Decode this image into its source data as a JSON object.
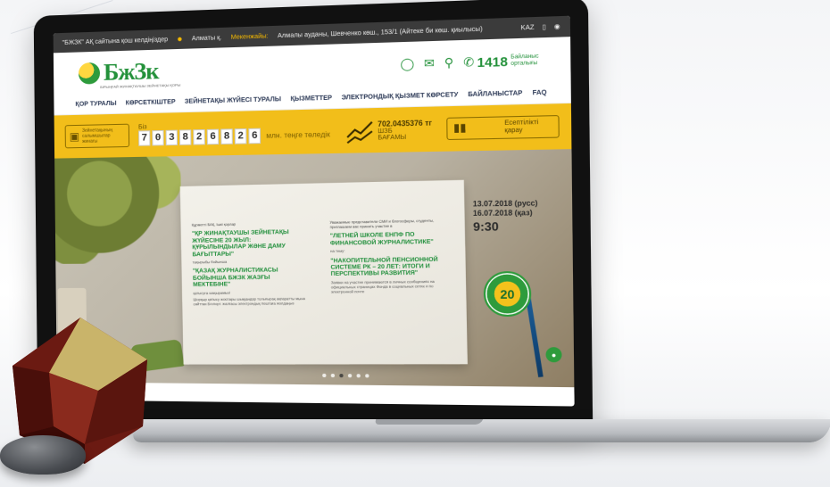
{
  "topbar": {
    "org_text": "\"БЖЗК\" АҚ сайтына қош келдіңіздер",
    "city": "Алматы қ.",
    "address_label": "Мекенжайы:",
    "address": "Алмалы ауданы, Шевченко көш., 153/1 (Айтеке би көш. қиылысы)",
    "lang": "KAZ"
  },
  "header": {
    "logo_text": "БжЗк",
    "logo_sub": "БІРЫҢҒАЙ ЖИНАҚТАУШЫ ЗЕЙНЕТАҚЫ ҚОРЫ",
    "phone": "1418",
    "phone_sub": "Байланыс орталығы"
  },
  "nav": {
    "items": [
      "ҚОР ТУРАЛЫ",
      "КӨРСЕТКІШТЕР",
      "ЗЕЙНЕТАҚЫ ЖҮЙЕСІ ТУРАЛЫ",
      "ҚЫЗМЕТТЕР",
      "ЭЛЕКТРОНДЫҚ ҚЫЗМЕТ КӨРСЕТУ",
      "БАЙЛАНЫСТАР",
      "FAQ"
    ]
  },
  "yellowbar": {
    "box_label": "Зейнетақының салымшылар жинағы",
    "counter_label": "Біз",
    "digits": [
      "7",
      "0",
      "3",
      "8",
      "2",
      "6",
      "8",
      "2",
      "6"
    ],
    "counter_unit": "млн. теңге төледік",
    "rate_value": "702.0435376 тг",
    "rate_label1": "ШЗБ",
    "rate_label2": "БАҒАМЫ",
    "report_label": "Есептілікті қарау"
  },
  "hero": {
    "left": {
      "intro": "Құрметті БАҚ, Ішкі қорлар",
      "headline1": "\"ҚР ЖИНАҚТАУШЫ ЗЕЙНЕТАҚЫ ЖҮЙЕСІНЕ 20 ЖЫЛ: ҚҰРЫЛЫНДЫЛАР ЖӘНЕ ДАМУ БАҒЫТТАРЫ\"",
      "sub1": "тақырыбы бойынша",
      "headline2": "\"ҚАЗАҚ ЖУРНАЛИСТИКАСЫ БОЙЫНША БЖЗК ЖАЗҒЫ МЕКТЕБІНЕ\"",
      "sub2": "қатысуға шақырамыз!",
      "footer": "Шорқыр қатысу жоспары шыққандар толығырақ ақпаратты мына сайттан Бгспорт. жалғасы электрондық поштаға жолдаңыз"
    },
    "right": {
      "intro": "Уважаемые представители СМИ и блогосферы, студенты, приглашаем вас принять участие в",
      "headline1": "\"ЛЕТНЕЙ ШКОЛЕ ЕНПФ ПО ФИНАНСОВОЙ ЖУРНАЛИСТИКЕ\"",
      "sub1": "на тему:",
      "headline2": "\"НАКОПИТЕЛЬНОЙ ПЕНСИОННОЙ СИСТЕМЕ РК – 20 ЛЕТ: ИТОГИ И ПЕРСПЕКТИВЫ РАЗВИТИЯ\"",
      "footer": "Заявки на участие принимаются в личных сообщениях на официальных страницах Фонда в социальных сетях и по электронной почте"
    },
    "event_date1": "13.07.2018 (русс)",
    "event_date2": "16.07.2018 (қаз)",
    "event_time": "9:30",
    "badge": "20"
  },
  "slider": {
    "count": 6,
    "active": 2
  }
}
